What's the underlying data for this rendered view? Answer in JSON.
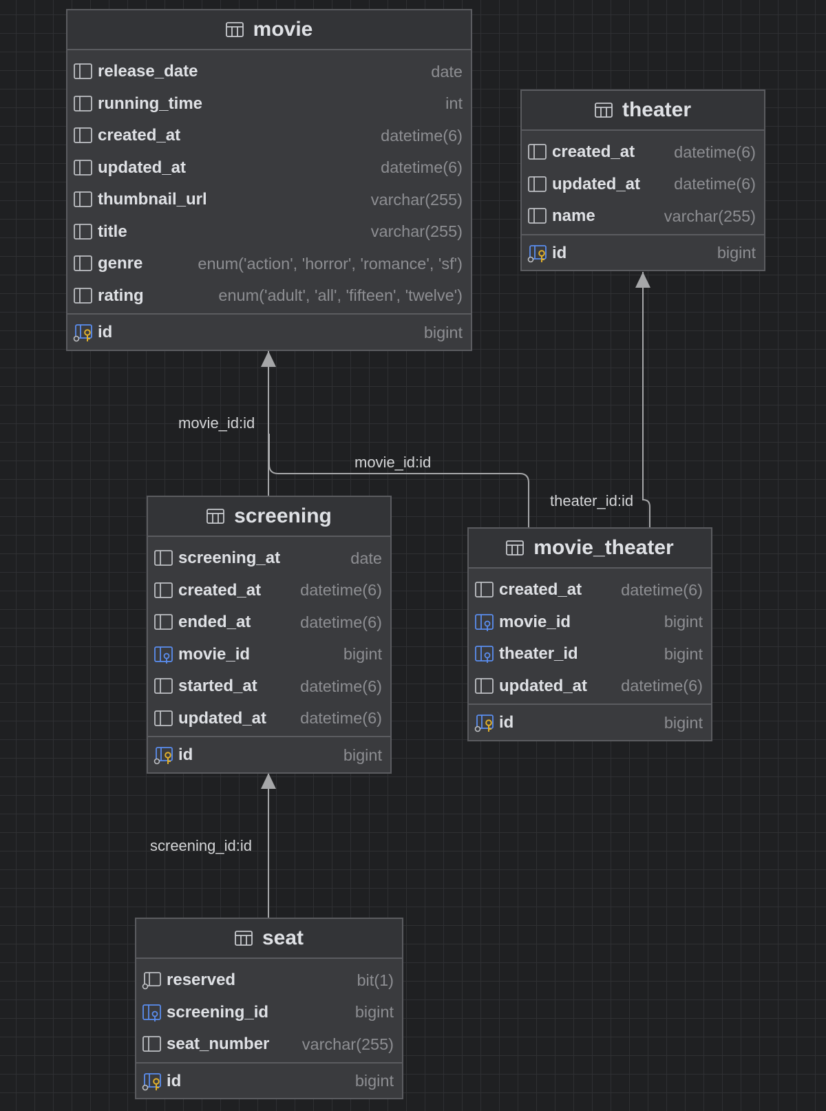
{
  "diagram": {
    "tables": [
      {
        "key": "movie",
        "name": "movie",
        "columns": [
          {
            "name": "release_date",
            "type": "date",
            "icon": "column-icon"
          },
          {
            "name": "running_time",
            "type": "int",
            "icon": "column-icon"
          },
          {
            "name": "created_at",
            "type": "datetime(6)",
            "icon": "column-icon"
          },
          {
            "name": "updated_at",
            "type": "datetime(6)",
            "icon": "column-icon"
          },
          {
            "name": "thumbnail_url",
            "type": "varchar(255)",
            "icon": "column-icon"
          },
          {
            "name": "title",
            "type": "varchar(255)",
            "icon": "column-icon"
          },
          {
            "name": "genre",
            "type": "enum('action', 'horror', 'romance', 'sf')",
            "icon": "column-icon"
          },
          {
            "name": "rating",
            "type": "enum('adult', 'all', 'fifteen', 'twelve')",
            "icon": "column-icon"
          }
        ],
        "primary_key": {
          "name": "id",
          "type": "bigint",
          "icon": "primary-key-icon"
        }
      },
      {
        "key": "theater",
        "name": "theater",
        "columns": [
          {
            "name": "created_at",
            "type": "datetime(6)",
            "icon": "column-icon"
          },
          {
            "name": "updated_at",
            "type": "datetime(6)",
            "icon": "column-icon"
          },
          {
            "name": "name",
            "type": "varchar(255)",
            "icon": "column-icon"
          }
        ],
        "primary_key": {
          "name": "id",
          "type": "bigint",
          "icon": "primary-key-icon"
        }
      },
      {
        "key": "screening",
        "name": "screening",
        "columns": [
          {
            "name": "screening_at",
            "type": "date",
            "icon": "column-icon"
          },
          {
            "name": "created_at",
            "type": "datetime(6)",
            "icon": "column-icon"
          },
          {
            "name": "ended_at",
            "type": "datetime(6)",
            "icon": "column-icon"
          },
          {
            "name": "movie_id",
            "type": "bigint",
            "icon": "foreign-key-icon"
          },
          {
            "name": "started_at",
            "type": "datetime(6)",
            "icon": "column-icon"
          },
          {
            "name": "updated_at",
            "type": "datetime(6)",
            "icon": "column-icon"
          }
        ],
        "primary_key": {
          "name": "id",
          "type": "bigint",
          "icon": "primary-key-icon"
        }
      },
      {
        "key": "movie_theater",
        "name": "movie_theater",
        "columns": [
          {
            "name": "created_at",
            "type": "datetime(6)",
            "icon": "column-icon"
          },
          {
            "name": "movie_id",
            "type": "bigint",
            "icon": "foreign-key-icon"
          },
          {
            "name": "theater_id",
            "type": "bigint",
            "icon": "foreign-key-icon"
          },
          {
            "name": "updated_at",
            "type": "datetime(6)",
            "icon": "column-icon"
          }
        ],
        "primary_key": {
          "name": "id",
          "type": "bigint",
          "icon": "primary-key-icon"
        }
      },
      {
        "key": "seat",
        "name": "seat",
        "columns": [
          {
            "name": "reserved",
            "type": "bit(1)",
            "icon": "not-null-column-icon"
          },
          {
            "name": "screening_id",
            "type": "bigint",
            "icon": "foreign-key-icon"
          },
          {
            "name": "seat_number",
            "type": "varchar(255)",
            "icon": "column-icon"
          }
        ],
        "primary_key": {
          "name": "id",
          "type": "bigint",
          "icon": "primary-key-icon"
        }
      }
    ],
    "relations": [
      {
        "key": "screening_to_movie",
        "from": "screening",
        "to": "movie",
        "label": "movie_id:id"
      },
      {
        "key": "movie_theater_to_movie",
        "from": "movie_theater",
        "to": "movie",
        "label": "movie_id:id"
      },
      {
        "key": "movie_theater_to_theater",
        "from": "movie_theater",
        "to": "theater",
        "label": "theater_id:id"
      },
      {
        "key": "seat_to_screening",
        "from": "seat",
        "to": "screening",
        "label": "screening_id:id"
      }
    ]
  },
  "colors": {
    "background": "#1f2022",
    "grid": "#2f3033",
    "table_body": "#3a3b3e",
    "table_header": "#333437",
    "border": "#5b5c60",
    "text": "#dfe1e5",
    "type_text": "#8d8e92",
    "edge": "#a6a7a9",
    "foreign_key_blue": "#5b8ef0",
    "primary_key_gold": "#e0b02c"
  }
}
